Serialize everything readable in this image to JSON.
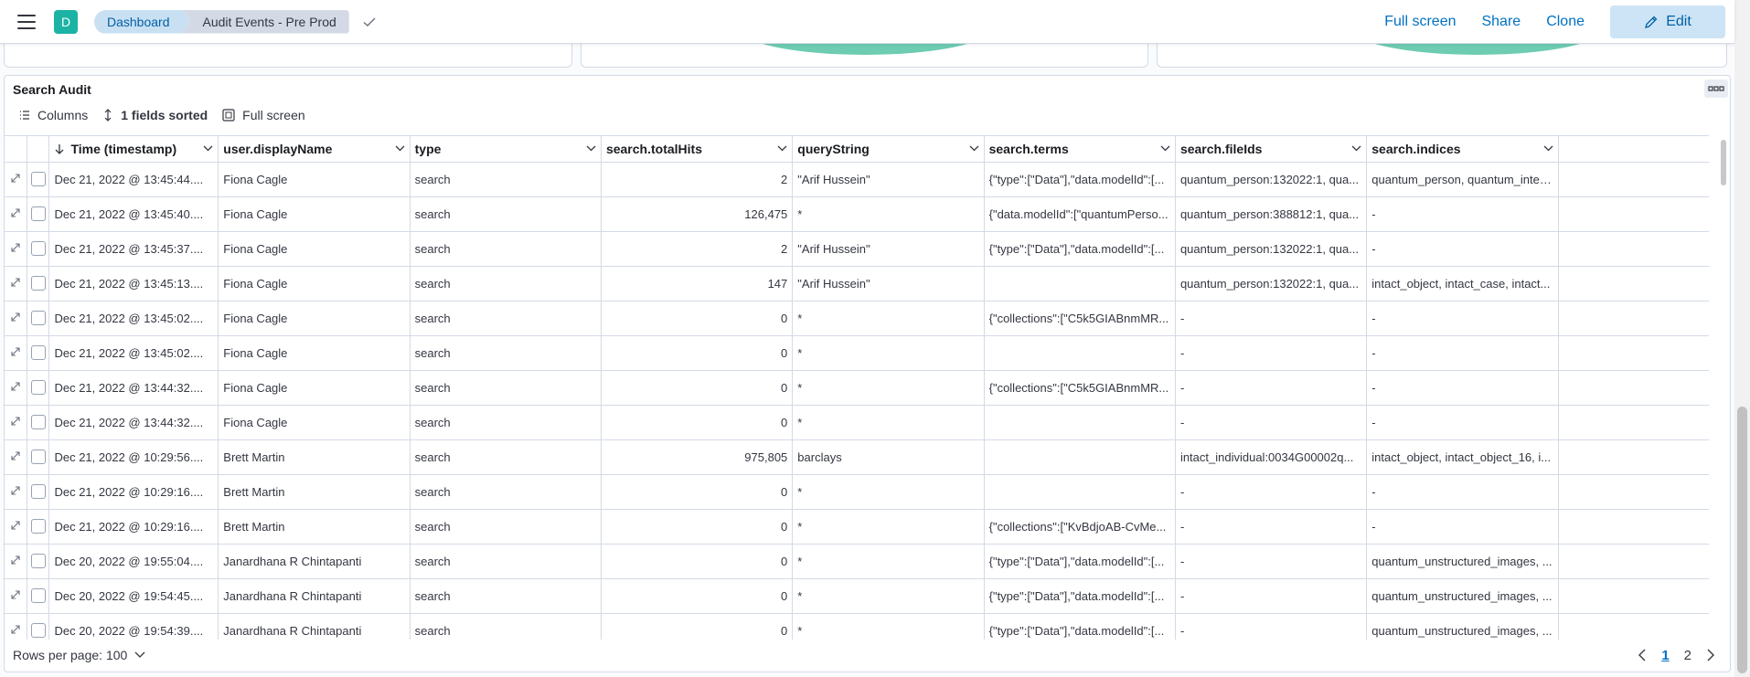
{
  "header": {
    "avatar_letter": "D",
    "breadcrumbs": [
      "Dashboard",
      "Audit Events - Pre Prod"
    ],
    "actions": [
      "Full screen",
      "Share",
      "Clone"
    ],
    "edit_label": "Edit"
  },
  "panel": {
    "title": "Search Audit",
    "toolbar": {
      "columns": "Columns",
      "sorted": "1 fields sorted",
      "fullscreen": "Full screen"
    }
  },
  "table": {
    "columns": [
      "Time (timestamp)",
      "user.displayName",
      "type",
      "search.totalHits",
      "queryString",
      "search.terms",
      "search.fileIds",
      "search.indices"
    ],
    "rows": [
      [
        "Dec 21, 2022 @ 13:45:44....",
        "Fiona Cagle",
        "search",
        "2",
        "\"Arif Hussein\"",
        "{\"type\":[\"Data\"],\"data.modelId\":[...",
        "quantum_person:132022:1, qua...",
        "quantum_person, quantum_intell..."
      ],
      [
        "Dec 21, 2022 @ 13:45:40....",
        "Fiona Cagle",
        "search",
        "126,475",
        "*",
        "{\"data.modelId\":[\"quantumPerso...",
        "quantum_person:388812:1, qua...",
        "-"
      ],
      [
        "Dec 21, 2022 @ 13:45:37....",
        "Fiona Cagle",
        "search",
        "2",
        "\"Arif Hussein\"",
        "{\"type\":[\"Data\"],\"data.modelId\":[...",
        "quantum_person:132022:1, qua...",
        "-"
      ],
      [
        "Dec 21, 2022 @ 13:45:13....",
        "Fiona Cagle",
        "search",
        "147",
        "\"Arif Hussein\"",
        "",
        "quantum_person:132022:1, qua...",
        "intact_object, intact_case, intact..."
      ],
      [
        "Dec 21, 2022 @ 13:45:02....",
        "Fiona Cagle",
        "search",
        "0",
        "*",
        "{\"collections\":[\"C5k5GIABnmMR...",
        "-",
        "-"
      ],
      [
        "Dec 21, 2022 @ 13:45:02....",
        "Fiona Cagle",
        "search",
        "0",
        "*",
        "",
        "-",
        "-"
      ],
      [
        "Dec 21, 2022 @ 13:44:32....",
        "Fiona Cagle",
        "search",
        "0",
        "*",
        "{\"collections\":[\"C5k5GIABnmMR...",
        "-",
        "-"
      ],
      [
        "Dec 21, 2022 @ 13:44:32....",
        "Fiona Cagle",
        "search",
        "0",
        "*",
        "",
        "-",
        "-"
      ],
      [
        "Dec 21, 2022 @ 10:29:56....",
        "Brett Martin",
        "search",
        "975,805",
        "barclays",
        "",
        "intact_individual:0034G00002q...",
        "intact_object, intact_object_16, i..."
      ],
      [
        "Dec 21, 2022 @ 10:29:16....",
        "Brett Martin",
        "search",
        "0",
        "*",
        "",
        "-",
        "-"
      ],
      [
        "Dec 21, 2022 @ 10:29:16....",
        "Brett Martin",
        "search",
        "0",
        "*",
        "{\"collections\":[\"KvBdjoAB-CvMe...",
        "-",
        "-"
      ],
      [
        "Dec 20, 2022 @ 19:55:04....",
        "Janardhana R Chintapanti",
        "search",
        "0",
        "*",
        "{\"type\":[\"Data\"],\"data.modelId\":[...",
        "-",
        "quantum_unstructured_images, ..."
      ],
      [
        "Dec 20, 2022 @ 19:54:45....",
        "Janardhana R Chintapanti",
        "search",
        "0",
        "*",
        "{\"type\":[\"Data\"],\"data.modelId\":[...",
        "-",
        "quantum_unstructured_images, ..."
      ],
      [
        "Dec 20, 2022 @ 19:54:39....",
        "Janardhana R Chintapanti",
        "search",
        "0",
        "*",
        "{\"type\":[\"Data\"],\"data.modelId\":[...",
        "-",
        "quantum_unstructured_images, ..."
      ]
    ]
  },
  "footer": {
    "rows_per_page": "Rows per page: 100",
    "pages": [
      "1",
      "2"
    ]
  }
}
